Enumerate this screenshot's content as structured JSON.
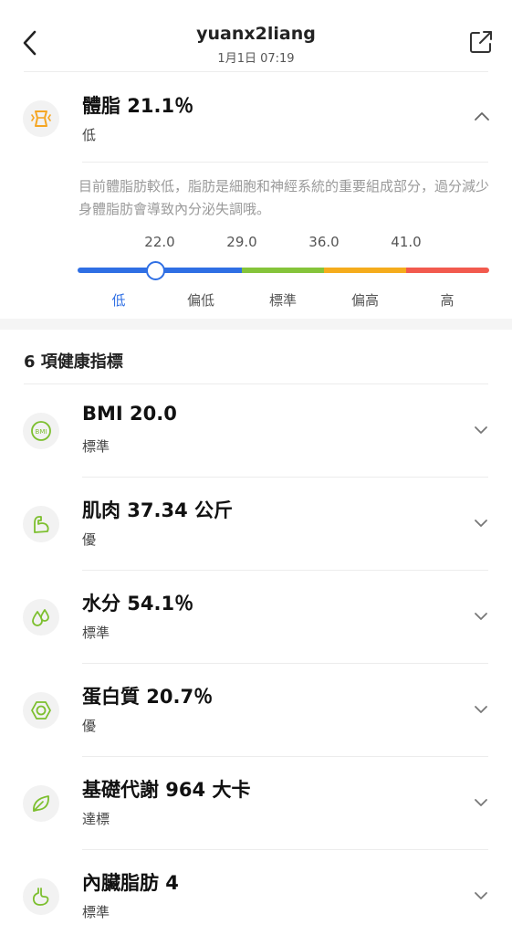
{
  "header": {
    "title": "yuanx2liang",
    "subtitle": "1月1日 07:19"
  },
  "body_fat": {
    "title": "體脂 21.1％",
    "status": "低",
    "value_percent": 21.1,
    "description": "目前體脂肪較低，脂肪是細胞和神經系統的重要組成部分，過分減少身體脂肪會導致內分泌失調哦。",
    "thresholds": [
      "22.0",
      "29.0",
      "36.0",
      "41.0"
    ],
    "levels": [
      "低",
      "偏低",
      "標準",
      "偏高",
      "高"
    ],
    "active_level": "低",
    "colors": {
      "low": "#2f6fe4",
      "standard": "#85c43a",
      "high_mid": "#f5ac1c",
      "high": "#f25a4e"
    }
  },
  "metrics": {
    "heading": "6 項健康指標",
    "items": [
      {
        "title": "BMI 20.0",
        "status": "標準",
        "icon": "bmi-icon"
      },
      {
        "title": "肌肉 37.34 公斤",
        "status": "優",
        "icon": "muscle-icon"
      },
      {
        "title": "水分 54.1％",
        "status": "標準",
        "icon": "water-drop-icon"
      },
      {
        "title": "蛋白質 20.7％",
        "status": "優",
        "icon": "protein-icon"
      },
      {
        "title": "基礎代謝 964 大卡",
        "status": "達標",
        "icon": "leaf-icon"
      },
      {
        "title": "內臟脂肪 4",
        "status": "標準",
        "icon": "organ-icon"
      }
    ],
    "icon_color": "#7cbf2e"
  }
}
